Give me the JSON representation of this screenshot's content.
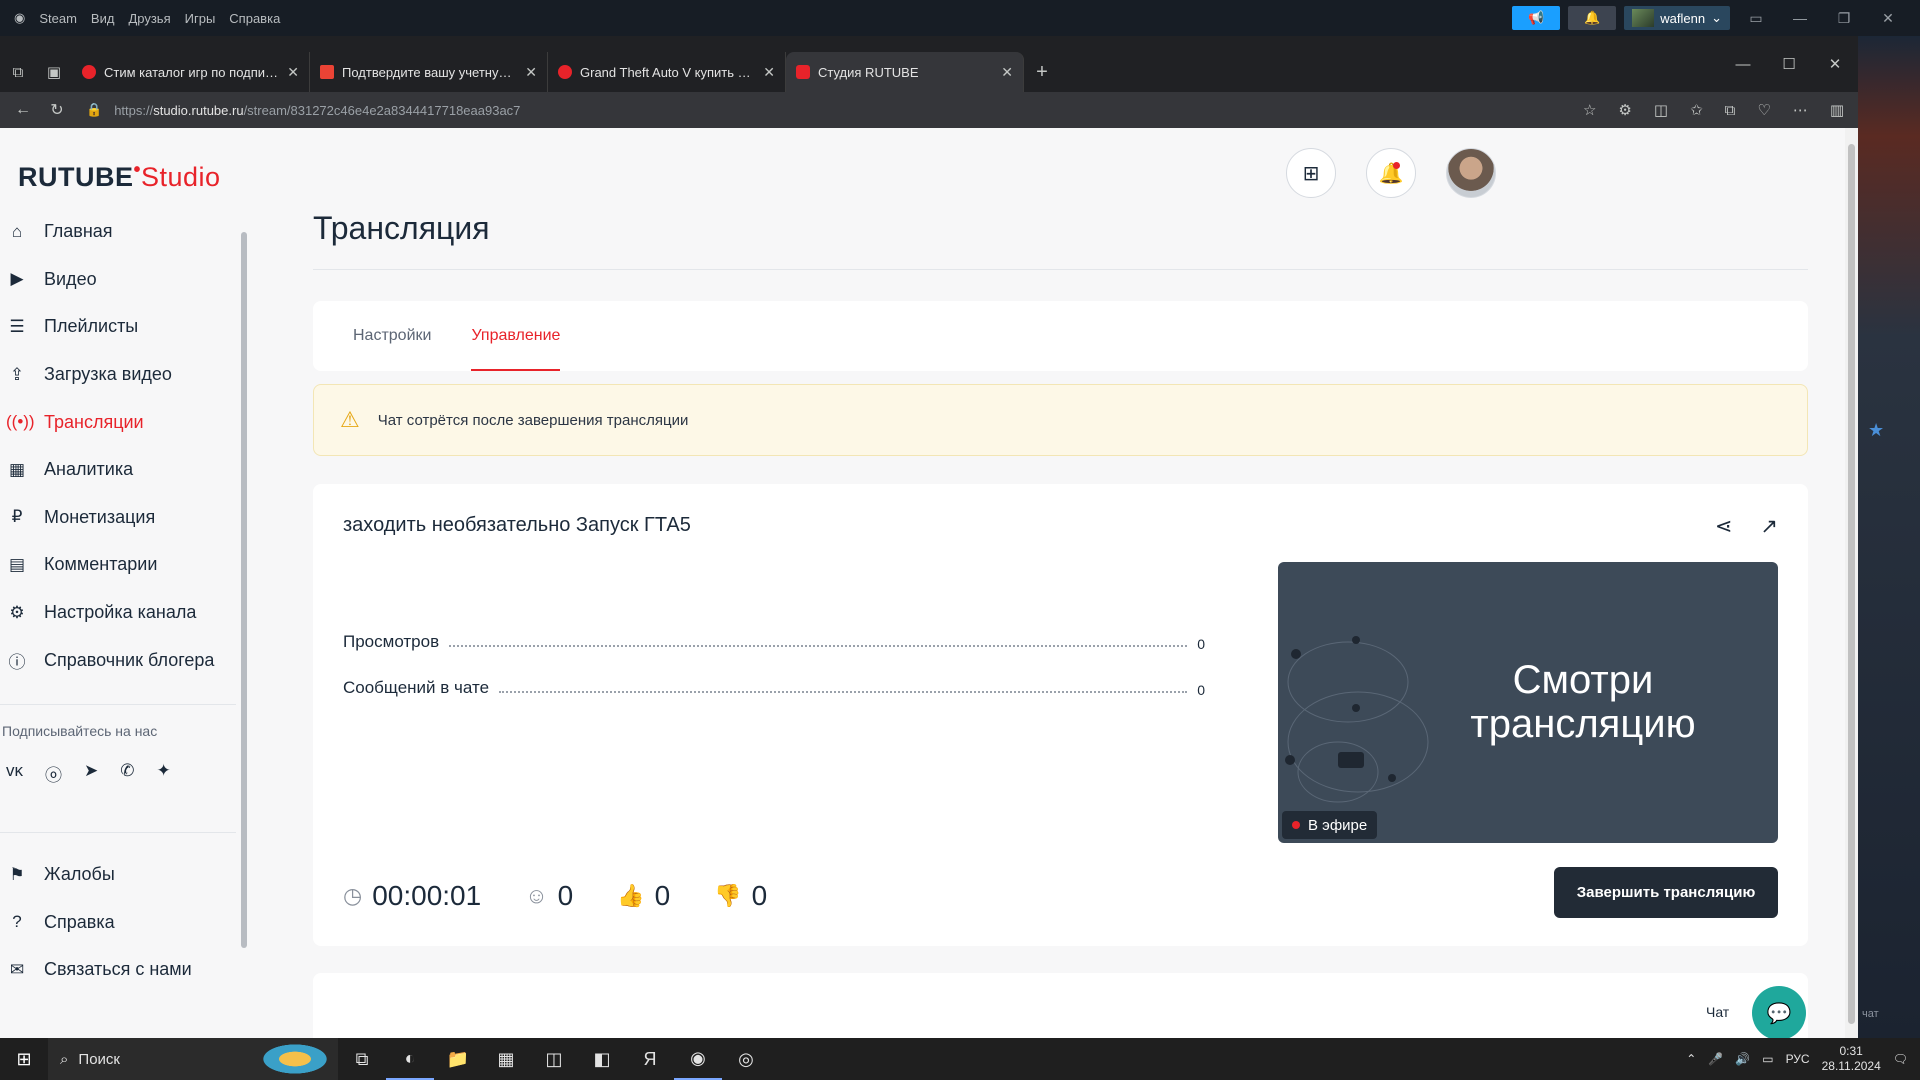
{
  "steam": {
    "menu": [
      "Steam",
      "Вид",
      "Друзья",
      "Игры",
      "Справка"
    ],
    "username": "waflenn"
  },
  "browser": {
    "tabs": [
      {
        "title": "Стим каталог игр по подписке -",
        "color": "#e8232a"
      },
      {
        "title": "Подтвердите вашу учетную запи",
        "color": "#ea4335"
      },
      {
        "title": "Grand Theft Auto V купить Стим",
        "color": "#e8232a"
      },
      {
        "title": "Студия RUTUBE",
        "color": "#e8232a"
      }
    ],
    "url_prefix": "https://",
    "url_host": "studio.rutube.ru",
    "url_path": "/stream/831272c46e4e2a8344417718eaa93ac7"
  },
  "logo": {
    "main": "RUTUBE",
    "studio": "Studio"
  },
  "sidebar": {
    "items": [
      {
        "label": "Главная",
        "icon": "home-icon"
      },
      {
        "label": "Видео",
        "icon": "video-icon"
      },
      {
        "label": "Плейлисты",
        "icon": "playlist-icon"
      },
      {
        "label": "Загрузка видео",
        "icon": "upload-icon"
      },
      {
        "label": "Трансляции",
        "icon": "broadcast-icon"
      },
      {
        "label": "Аналитика",
        "icon": "analytics-icon"
      },
      {
        "label": "Монетизация",
        "icon": "money-icon"
      },
      {
        "label": "Комментарии",
        "icon": "comment-icon"
      },
      {
        "label": "Настройка канала",
        "icon": "gear-icon"
      },
      {
        "label": "Справочник блогера",
        "icon": "guide-icon"
      }
    ],
    "follow_label": "Подписывайтесь на нас",
    "bottom_items": [
      {
        "label": "Жалобы",
        "icon": "flag-icon"
      },
      {
        "label": "Справка",
        "icon": "help-icon"
      },
      {
        "label": "Связаться с нами",
        "icon": "mail-icon"
      }
    ]
  },
  "main": {
    "title": "Трансляция",
    "tabs": [
      {
        "label": "Настройки"
      },
      {
        "label": "Управление"
      }
    ],
    "alert": "Чат сотрётся после завершения трансляции",
    "stream": {
      "title": "заходить необязательно Запуск ГТА5",
      "views_label": "Просмотров",
      "views_value": "0",
      "messages_label": "Сообщений в чате",
      "messages_value": "0",
      "preview_text_line1": "Смотри",
      "preview_text_line2": "трансляцию",
      "live_label": "В эфире",
      "duration": "00:00:01",
      "viewers": "0",
      "likes": "0",
      "dislikes": "0",
      "end_button": "Завершить трансляцию"
    },
    "chat_label": "Чат"
  },
  "taskbar": {
    "search_placeholder": "Поиск",
    "lang": "РУС",
    "time": "0:31",
    "date": "28.11.2024"
  },
  "right_strip": {
    "chat_text": "чат"
  }
}
